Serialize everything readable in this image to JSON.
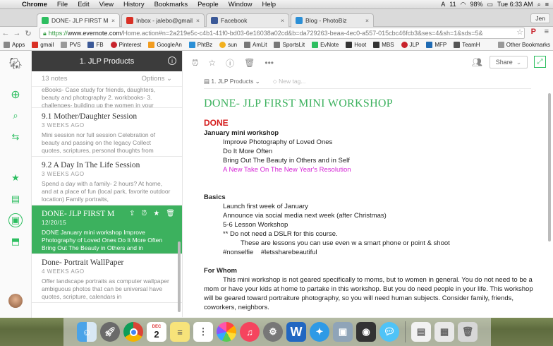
{
  "menubar": {
    "apple": "",
    "items": [
      "Chrome",
      "File",
      "Edit",
      "View",
      "History",
      "Bookmarks",
      "People",
      "Window",
      "Help"
    ],
    "battery": "98%",
    "badge": "11",
    "clock": "Tue 6:33 AM"
  },
  "tabs": [
    {
      "title": "DONE- JLP FIRST MINI W",
      "color": "#2dbe60"
    },
    {
      "title": "Inbox - jalebo@gmail.com",
      "color": "#d93025"
    },
    {
      "title": "Facebook",
      "color": "#3b5998"
    },
    {
      "title": "Blog - PhotoBiz",
      "color": "#2b8fd6"
    }
  ],
  "user": "Jen",
  "address": {
    "https": "https://",
    "domain": "www.evernote.com",
    "rest": "/Home.action#n=2a219e5c-c4b1-41f0-bd03-6e16038a02cd&b=da729263-beaa-4ec0-a557-015cbc46fcb3&ses=4&sh=1&sds=5&"
  },
  "bookmarks": [
    {
      "label": "Apps",
      "color": "#888"
    },
    {
      "label": "gmail",
      "color": "#d93025"
    },
    {
      "label": "PVS",
      "color": "#999"
    },
    {
      "label": "FB",
      "color": "#3b5998"
    },
    {
      "label": "Pinterest",
      "color": "#c8232c"
    },
    {
      "label": "GoogleAn",
      "color": "#f29c1f"
    },
    {
      "label": "PhtBz",
      "color": "#2b8fd6"
    },
    {
      "label": "sun",
      "color": "#f2b01e"
    },
    {
      "label": "AmLit",
      "color": "#777"
    },
    {
      "label": "SportsLit",
      "color": "#777"
    },
    {
      "label": "EvNote",
      "color": "#2dbe60"
    },
    {
      "label": "Hoot",
      "color": "#333"
    },
    {
      "label": "MBS",
      "color": "#333"
    },
    {
      "label": "JLP",
      "color": "#c8232c"
    },
    {
      "label": "MFP",
      "color": "#1e6ab3"
    },
    {
      "label": "TeamH",
      "color": "#555"
    }
  ],
  "bookmarks_other": "Other Bookmarks",
  "list": {
    "title": "1. JLP Products",
    "count": "13 notes",
    "options": "Options",
    "partial_top": "eBooks- Case study for friends, daughters, beauty and photography 2. workbooks- 3. challenges- building up the women in your",
    "notes": [
      {
        "title": "9.1 Mother/Daughter Session",
        "date": "3 WEEKS AGO",
        "snippet": "Mini session nor full session Celebration of beauty and passing on the legacy Collect quotes, scriptures, personal thoughts from"
      },
      {
        "title": "9.2 A Day In The Life Session",
        "date": "3 WEEKS AGO",
        "snippet": "Spend a day with a family- 2 hours? At home, and at a place of fun (local park, favorite outdoor location) Family portraits,"
      },
      {
        "title": "DONE- JLP FIRST MINI WORKSHOP",
        "date": "12/20/15",
        "snippet": "DONE January mini workshop Improve Photography of Loved Ones Do It More Often Bring Out The Beauty in Others and in"
      },
      {
        "title": "Done- Portrait WallPaper",
        "date": "4 WEEKS AGO",
        "snippet": "Offer landscape portraits as computer wallpaper ambiguous photos that can be universal have quotes, scripture, calendars in"
      }
    ]
  },
  "editor": {
    "notebook": "1. JLP Products",
    "tag_placeholder": "New tag...",
    "share": "Share",
    "title": "DONE- JLP FIRST MINI WORKSHOP",
    "done": "DONE",
    "s1_head": "January mini workshop",
    "s1": [
      "Improve Photography of Loved Ones",
      "Do It More Often",
      "Bring Out The Beauty in Others and in Self"
    ],
    "s1_pink": "A New Take On The New Year's Resolution",
    "s2_head": "Basics",
    "s2": [
      "Launch first week of January",
      "Announce via social media next week (after Christmas)",
      "5-6 Lesson Workshop",
      "** Do not need a DSLR for this course."
    ],
    "s2_sub": "These are lessons you can use even w a smart phone or point & shoot",
    "s2_tags": "#nonselfie    #letssharebeautiful",
    "s3_head": "For Whom",
    "s3_para": "This mini workshop is not geared specifically to moms, but to women in general.  You do not need to be a mom or have your kids at home to partake in this workshop.  But you do need people in your life.  This workshop will be geared toward portraiture photography, so you will need human subjects.  Consider family, friends, coworkers, neighbors."
  },
  "dock": {
    "calendar_month": "DEC",
    "calendar_day": "2"
  }
}
